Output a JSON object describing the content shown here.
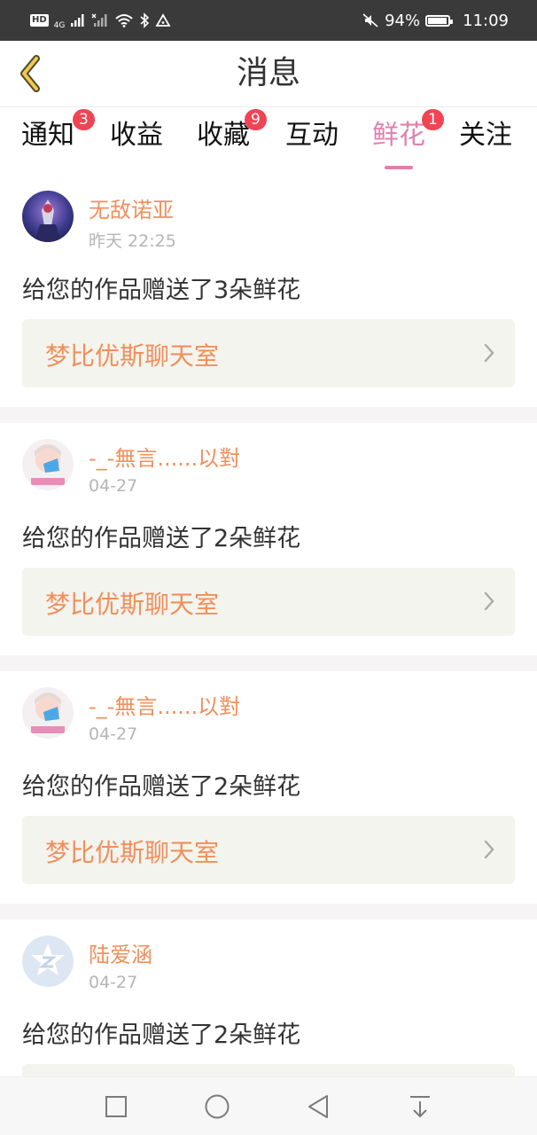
{
  "status_bar": {
    "network": "4G",
    "battery_percent": "94%",
    "battery_level": 0.94,
    "time": "11:09",
    "icons": [
      "hd-icon",
      "signal-4g-icon",
      "signal-icon",
      "wifi-icon",
      "bluetooth-icon",
      "alert-icon",
      "mute-icon",
      "battery-icon"
    ]
  },
  "header": {
    "title": "消息",
    "back_icon": "chevron-left-icon"
  },
  "tabs": [
    {
      "label": "通知",
      "badge": "3",
      "active": false
    },
    {
      "label": "收益",
      "badge": "",
      "active": false
    },
    {
      "label": "收藏",
      "badge": "9",
      "active": false
    },
    {
      "label": "互动",
      "badge": "",
      "active": false
    },
    {
      "label": "鲜花",
      "badge": "1",
      "active": true
    },
    {
      "label": "关注",
      "badge": "",
      "active": false
    }
  ],
  "feed": [
    {
      "username": "无敌诺亚",
      "time": "昨天 22:25",
      "message": "给您的作品赠送了3朵鲜花",
      "link": "梦比优斯聊天室"
    },
    {
      "username": "-_-無言......以對",
      "time": "04-27",
      "message": "给您的作品赠送了2朵鲜花",
      "link": "梦比优斯聊天室"
    },
    {
      "username": "-_-無言......以對",
      "time": "04-27",
      "message": "给您的作品赠送了2朵鲜花",
      "link": "梦比优斯聊天室"
    },
    {
      "username": "陆爱涵",
      "time": "04-27",
      "message": "给您的作品赠送了2朵鲜花",
      "link": ""
    }
  ],
  "nav_bar": {
    "icons": [
      "recent-apps-icon",
      "home-icon",
      "back-icon",
      "notification-pull-icon"
    ]
  },
  "colors": {
    "accent_pink": "#e27fae",
    "username_orange": "#f08f5c",
    "badge_red": "#f04454",
    "link_box_bg": "#f4f4ee",
    "separator": "#f6f4f5",
    "status_bar_bg": "#3a3a3a"
  }
}
